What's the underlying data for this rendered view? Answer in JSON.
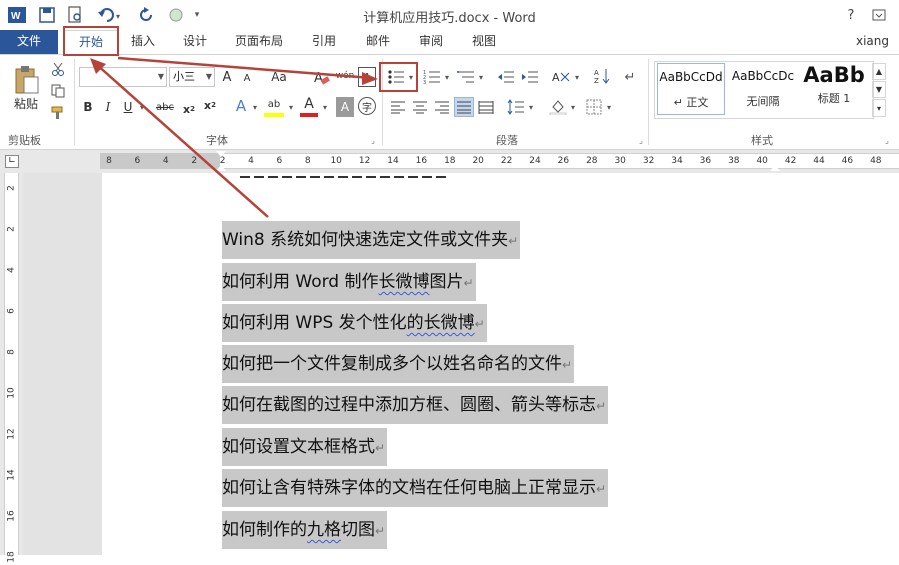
{
  "titlebar": {
    "title": "计算机应用技巧.docx - Word",
    "help": "?"
  },
  "tabs": [
    "文件",
    "开始",
    "插入",
    "设计",
    "页面布局",
    "引用",
    "邮件",
    "审阅",
    "视图"
  ],
  "user": "xiang",
  "ribbon": {
    "clipboard": {
      "paste": "粘贴",
      "label": "剪贴板"
    },
    "font": {
      "font_name": "",
      "font_size": "小三",
      "label": "字体",
      "grow": "A",
      "shrink": "A",
      "case": "Aa",
      "phonetic": "wén",
      "border_char": "A",
      "bold": "B",
      "italic": "I",
      "underline": "U",
      "strike": "abc",
      "sub": "x",
      "sup": "x",
      "effects": "A",
      "highlight": "ab",
      "color": "A",
      "shade": "A",
      "enclose": "字"
    },
    "paragraph": {
      "label": "段落"
    },
    "styles": {
      "label": "样式",
      "items": [
        {
          "preview": "AaBbCcDd",
          "name": "正文"
        },
        {
          "preview": "AaBbCcDc",
          "name": "无间隔"
        },
        {
          "preview": "AaBb",
          "name": "标题 1"
        }
      ]
    }
  },
  "ruler": {
    "h_numbers": [
      "8",
      "6",
      "4",
      "2",
      "2",
      "4",
      "6",
      "8",
      "10",
      "12",
      "14",
      "16",
      "18",
      "20",
      "22",
      "24",
      "26",
      "28",
      "30",
      "32",
      "34",
      "36",
      "38",
      "40",
      "42",
      "44",
      "46",
      "48"
    ],
    "v_numbers": [
      "2",
      "2",
      "4",
      "6",
      "8",
      "10",
      "12",
      "14",
      "16",
      "18"
    ]
  },
  "document": {
    "lines": [
      "Win8 系统如何快速选定文件或文件夹",
      "如何利用 Word 制作长微博图片",
      "如何利用 WPS 发个性化的长微博",
      "如何把一个文件复制成多个以姓名命名的文件",
      "如何在截图的过程中添加方框、圆圈、箭头等标志",
      "如何设置文本框格式",
      "如何让含有特殊字体的文档在任何电脑上正常显示",
      "如何制作的九格切图"
    ],
    "paragraph_mark": "↵"
  }
}
